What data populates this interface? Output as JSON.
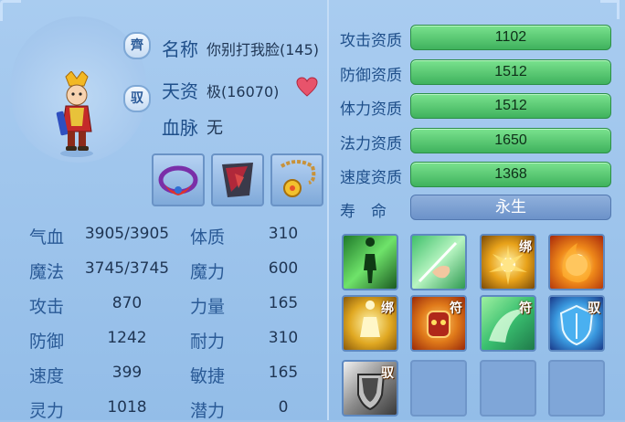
{
  "pet": {
    "name_label": "名称",
    "name_value": "你别打我脸(145)",
    "aptitude_label": "天资",
    "aptitude_value": "极(16070)",
    "bloodline_label": "血脉",
    "bloodline_value": "无",
    "badge_top": "齊",
    "badge_mid": "驭"
  },
  "stats": [
    {
      "label": "气血",
      "value": "3905/3905",
      "label2": "体质",
      "value2": "310"
    },
    {
      "label": "魔法",
      "value": "3745/3745",
      "label2": "魔力",
      "value2": "600"
    },
    {
      "label": "攻击",
      "value": "870",
      "label2": "力量",
      "value2": "165"
    },
    {
      "label": "防御",
      "value": "1242",
      "label2": "耐力",
      "value2": "310"
    },
    {
      "label": "速度",
      "value": "399",
      "label2": "敏捷",
      "value2": "165"
    },
    {
      "label": "灵力",
      "value": "1018",
      "label2": "潜力",
      "value2": "0"
    }
  ],
  "aptitudes": [
    {
      "label": "攻击资质",
      "value": "1102"
    },
    {
      "label": "防御资质",
      "value": "1512"
    },
    {
      "label": "体力资质",
      "value": "1512"
    },
    {
      "label": "法力资质",
      "value": "1650"
    },
    {
      "label": "速度资质",
      "value": "1368"
    }
  ],
  "lifespan": {
    "label": "寿　命",
    "value": "永生"
  },
  "skills": [
    {
      "icon": "figure-aura-icon",
      "tag": ""
    },
    {
      "icon": "hand-slash-icon",
      "tag": ""
    },
    {
      "icon": "golden-burst-icon",
      "tag": "绑"
    },
    {
      "icon": "fireball-icon",
      "tag": ""
    },
    {
      "icon": "golden-figure-icon",
      "tag": "绑"
    },
    {
      "icon": "demon-mask-icon",
      "tag": "符"
    },
    {
      "icon": "green-swirl-icon",
      "tag": "符"
    },
    {
      "icon": "blue-shield-icon",
      "tag": "驭"
    },
    {
      "icon": "silver-shield-icon",
      "tag": "驭"
    }
  ],
  "colors": {
    "panel": "#9ec3ea",
    "aptitude_bar": "#3fb25d",
    "label_text": "#1f4f8a",
    "heart": "#e8536b"
  }
}
